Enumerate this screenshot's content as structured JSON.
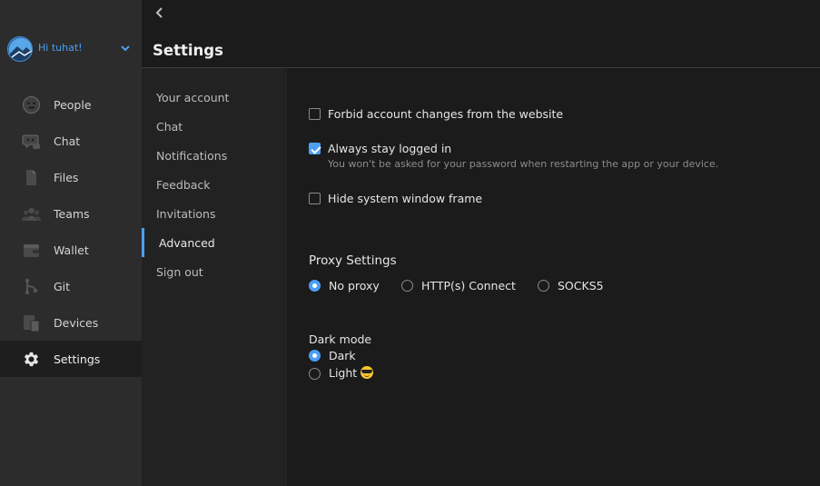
{
  "user": {
    "greeting": "Hi tuhat!"
  },
  "nav": {
    "items": [
      {
        "label": "People",
        "icon": "people-icon"
      },
      {
        "label": "Chat",
        "icon": "chat-icon"
      },
      {
        "label": "Files",
        "icon": "file-icon"
      },
      {
        "label": "Teams",
        "icon": "teams-icon"
      },
      {
        "label": "Wallet",
        "icon": "wallet-icon"
      },
      {
        "label": "Git",
        "icon": "git-icon"
      },
      {
        "label": "Devices",
        "icon": "devices-icon"
      },
      {
        "label": "Settings",
        "icon": "gear-icon",
        "active": true
      }
    ]
  },
  "header": {
    "title": "Settings"
  },
  "submenu": {
    "items": [
      {
        "label": "Your account"
      },
      {
        "label": "Chat"
      },
      {
        "label": "Notifications"
      },
      {
        "label": "Feedback"
      },
      {
        "label": "Invitations"
      },
      {
        "label": "Advanced",
        "active": true
      },
      {
        "label": "Sign out"
      }
    ]
  },
  "advanced": {
    "forbid_changes": {
      "label": "Forbid account changes from the website",
      "checked": false
    },
    "stay_logged_in": {
      "label": "Always stay logged in",
      "description": "You won't be asked for your password when restarting the app or your device.",
      "checked": true
    },
    "hide_frame": {
      "label": "Hide system window frame",
      "checked": false
    },
    "proxy": {
      "title": "Proxy Settings",
      "options": [
        "No proxy",
        "HTTP(s) Connect",
        "SOCKS5"
      ],
      "selected": "No proxy"
    },
    "dark_mode": {
      "title": "Dark mode",
      "options": [
        "Dark",
        "Light"
      ],
      "selected": "Dark"
    }
  },
  "colors": {
    "accent": "#4c9ff5",
    "nav_bg": "#2c2c2c",
    "content_bg": "#1b1b1b"
  }
}
